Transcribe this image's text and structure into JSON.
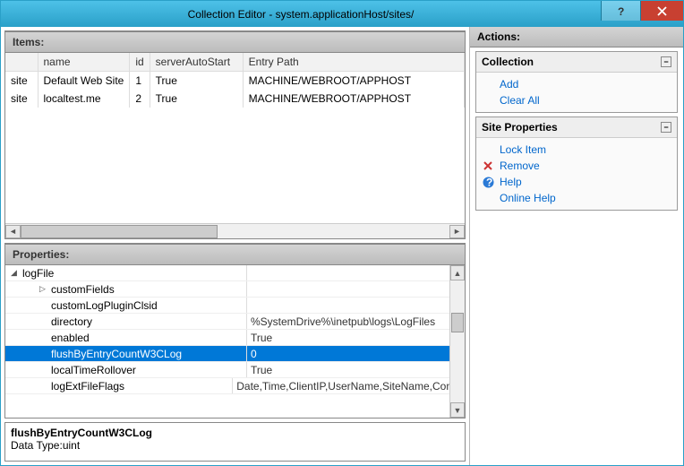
{
  "window": {
    "title": "Collection Editor - system.applicationHost/sites/"
  },
  "items_panel": {
    "label": "Items:",
    "headers": {
      "type": "",
      "name": "name",
      "id": "id",
      "sas": "serverAutoStart",
      "entry": "Entry Path"
    },
    "rows": [
      {
        "type": "site",
        "name": "Default Web Site",
        "id": "1",
        "sas": "True",
        "entry": "MACHINE/WEBROOT/APPHOST"
      },
      {
        "type": "site",
        "name": "localtest.me",
        "id": "2",
        "sas": "True",
        "entry": "MACHINE/WEBROOT/APPHOST"
      }
    ]
  },
  "props_panel": {
    "label": "Properties:",
    "root": "logFile",
    "rows": [
      {
        "name": "customFields",
        "value": "",
        "expander": "▷",
        "indent": 2
      },
      {
        "name": "customLogPluginClsid",
        "value": "",
        "indent": 2
      },
      {
        "name": "directory",
        "value": "%SystemDrive%\\inetpub\\logs\\LogFiles",
        "indent": 2
      },
      {
        "name": "enabled",
        "value": "True",
        "indent": 2
      },
      {
        "name": "flushByEntryCountW3CLog",
        "value": "0",
        "indent": 2,
        "selected": true
      },
      {
        "name": "localTimeRollover",
        "value": "True",
        "indent": 2
      },
      {
        "name": "logExtFileFlags",
        "value": "Date,Time,ClientIP,UserName,SiteName,Comp",
        "indent": 2
      }
    ]
  },
  "description": {
    "name": "flushByEntryCountW3CLog",
    "type": "Data Type:uint"
  },
  "actions": {
    "label": "Actions:",
    "collection": {
      "title": "Collection",
      "add": "Add",
      "clear": "Clear All"
    },
    "site_props": {
      "title": "Site Properties",
      "lock": "Lock Item",
      "remove": "Remove",
      "help": "Help",
      "online": "Online Help"
    }
  }
}
